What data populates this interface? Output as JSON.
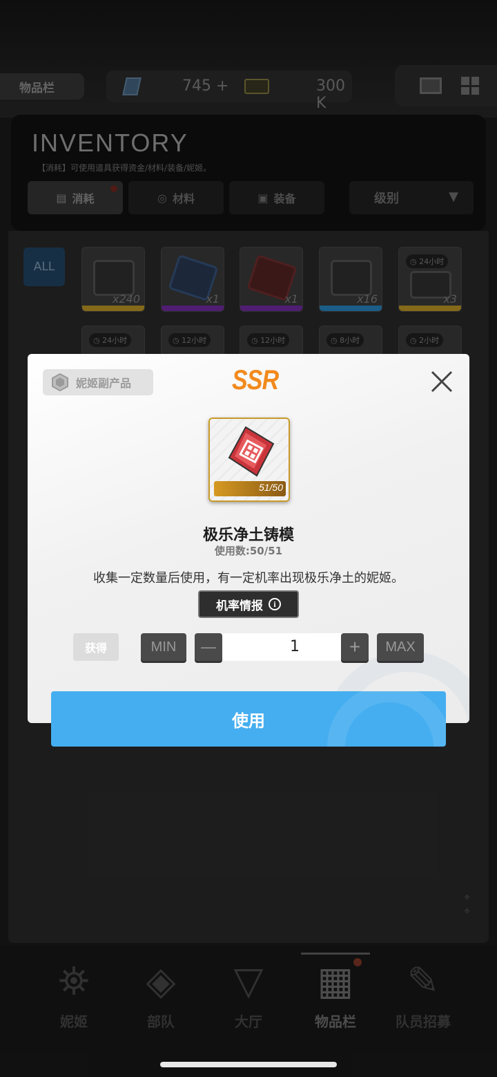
{
  "header": {
    "section_tag": "物品栏",
    "gems_value": "745",
    "gems_plus": "+",
    "credits_value": "300 K"
  },
  "inventory": {
    "title": "INVENTORY",
    "subtitle": "【消耗】可使用道具获得资金/材料/装备/妮姬。",
    "tabs": [
      {
        "label": "消耗",
        "icon": "consumable-icon"
      },
      {
        "label": "材料",
        "icon": "material-icon"
      },
      {
        "label": "装备",
        "icon": "equipment-icon"
      }
    ],
    "sort_label": "级别",
    "filter_all": "ALL",
    "row1": [
      {
        "qty": "x240",
        "rarity_color": "#c9a227"
      },
      {
        "qty": "x1",
        "rarity_color": "#7a2fb0"
      },
      {
        "qty": "x1",
        "rarity_color": "#7a2fb0"
      },
      {
        "qty": "x16",
        "rarity_color": "#2a8fd0"
      },
      {
        "qty": "x3",
        "rarity_color": "#c9a227",
        "timer": "24小时"
      }
    ],
    "row2_timers": [
      "24小时",
      "12小时",
      "12小时",
      "8小时",
      "2小时"
    ]
  },
  "modal": {
    "category": "妮姬副产品",
    "rarity": "SSR",
    "item_progress": "51/50",
    "item_name": "极乐净土铸模",
    "usage": "使用数:50/51",
    "description": "收集一定数量后使用，有一定机率出现极乐净土的妮姬。",
    "prob_button": "机率情报",
    "obtain_label": "获得",
    "min_label": "MIN",
    "minus_label": "—",
    "quantity": "1",
    "plus_label": "+",
    "max_label": "MAX",
    "use_button": "使用"
  },
  "nav": {
    "items": [
      {
        "label": "妮姬",
        "icon": "nikke-icon"
      },
      {
        "label": "部队",
        "icon": "squad-icon"
      },
      {
        "label": "大厅",
        "icon": "lobby-icon"
      },
      {
        "label": "物品栏",
        "icon": "inventory-icon"
      },
      {
        "label": "队员招募",
        "icon": "recruit-icon"
      }
    ]
  },
  "colors": {
    "accent_blue": "#45aef0",
    "ssr_orange": "#f28a1d",
    "card_gold": "#c99a2a"
  }
}
